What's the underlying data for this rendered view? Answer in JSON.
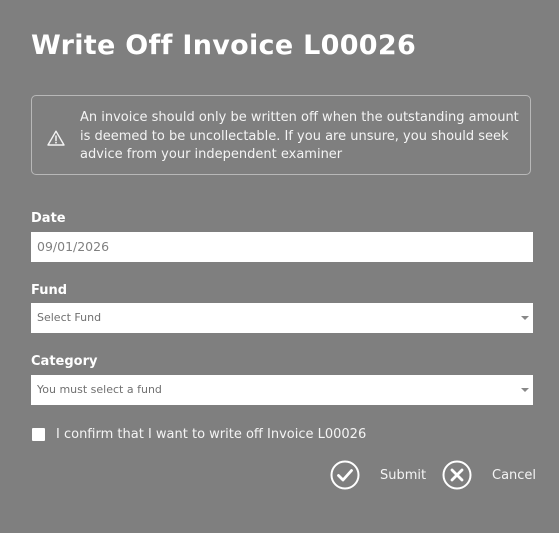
{
  "dialog": {
    "title": "Write Off Invoice L00026",
    "warning": {
      "icon": "warning-icon",
      "text": "An invoice should only be written off when the outstanding amount is deemed to be uncollectable. If you are unsure, you should seek advice from your independent examiner"
    },
    "fields": {
      "date": {
        "label": "Date",
        "value": "09/01/2026"
      },
      "fund": {
        "label": "Fund",
        "placeholder": "Select Fund"
      },
      "category": {
        "label": "Category",
        "placeholder": "You must select a fund"
      }
    },
    "confirm": {
      "label": "I confirm that I want to write off Invoice L00026",
      "checked": false
    },
    "actions": {
      "submit_label": "Submit",
      "submit_icon": "check-circle-icon",
      "cancel_label": "Cancel",
      "cancel_icon": "close-circle-icon"
    }
  },
  "colors": {
    "backdrop": "#7f7f7f",
    "text": "#ffffff",
    "field_bg": "#ffffff"
  }
}
